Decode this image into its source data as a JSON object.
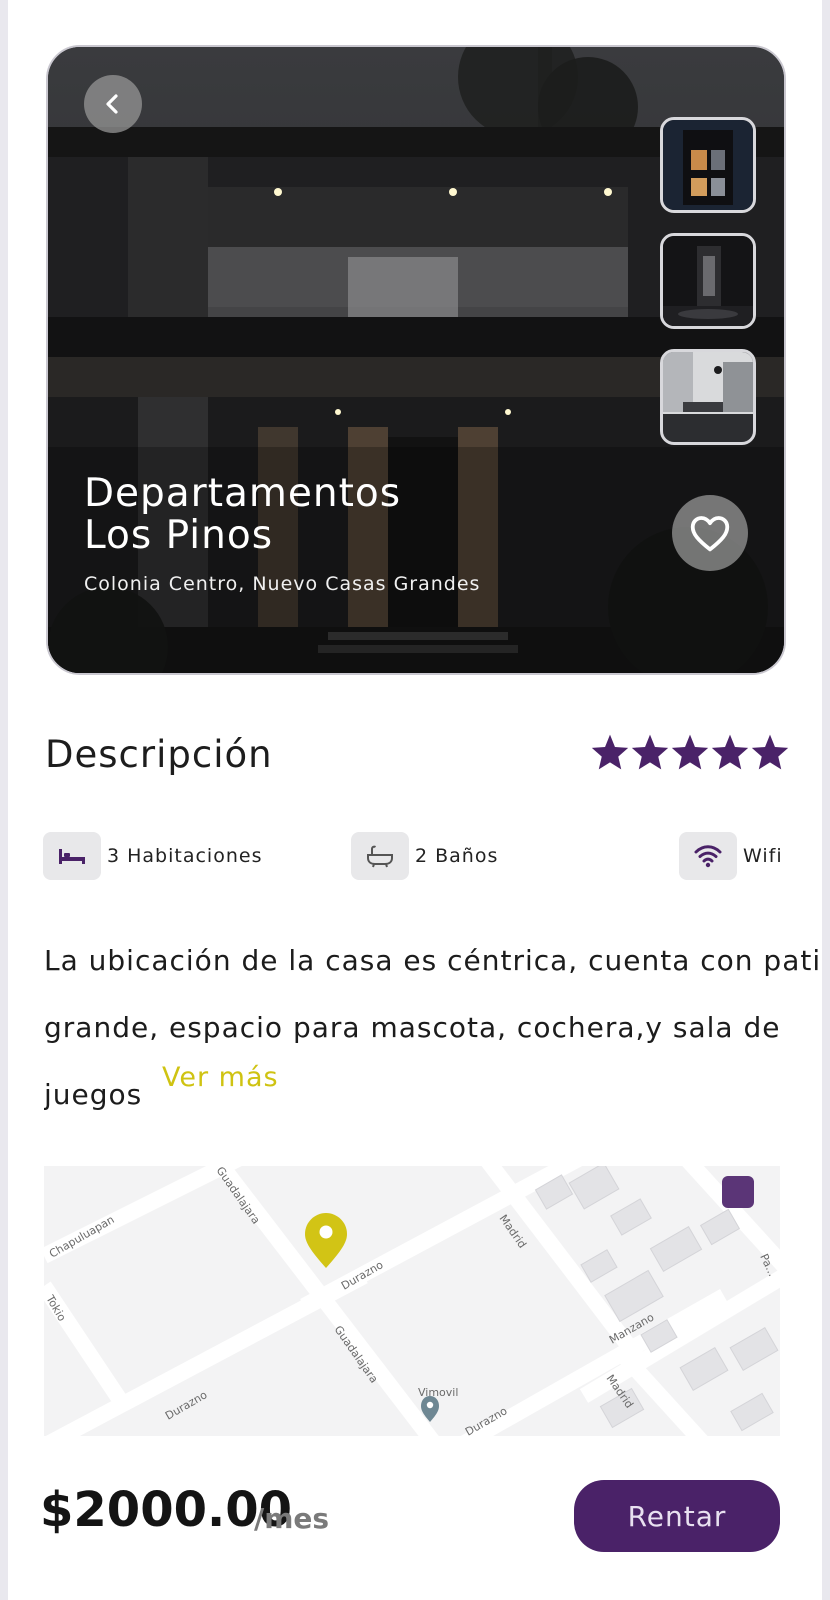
{
  "listing": {
    "title": "Departamentos\nLos Pinos",
    "location": "Colonia Centro, Nuevo Casas Grandes",
    "favorite": false,
    "thumbnails": [
      "exterior",
      "interior",
      "living-room"
    ]
  },
  "description": {
    "heading": "Descripción",
    "rating": 5,
    "rating_max": 5,
    "body_lines": [
      "La ubicación de la casa es céntrica, cuenta con patio",
      "grande, espacio para mascota, cochera,y sala de",
      "juegos"
    ],
    "more_label": "Ver más"
  },
  "amenities": [
    {
      "icon": "bed-icon",
      "label": "3 Habitaciones"
    },
    {
      "icon": "bathtub-icon",
      "label": "2 Baños"
    },
    {
      "icon": "wifi-icon",
      "label": "Wifi"
    }
  ],
  "map": {
    "streets": [
      "Chapuluapan",
      "Guadalajara",
      "Durazno",
      "Madrid",
      "Tokio",
      "Guadalajara",
      "Durazno",
      "Vimovil",
      "Manzano",
      "Madrid",
      "Durazno",
      "Pa..."
    ]
  },
  "footer": {
    "price": "$2000.00",
    "per": "/mes",
    "cta": "Rentar"
  },
  "colors": {
    "accent": "#4a2268",
    "highlight": "#cfc312"
  }
}
